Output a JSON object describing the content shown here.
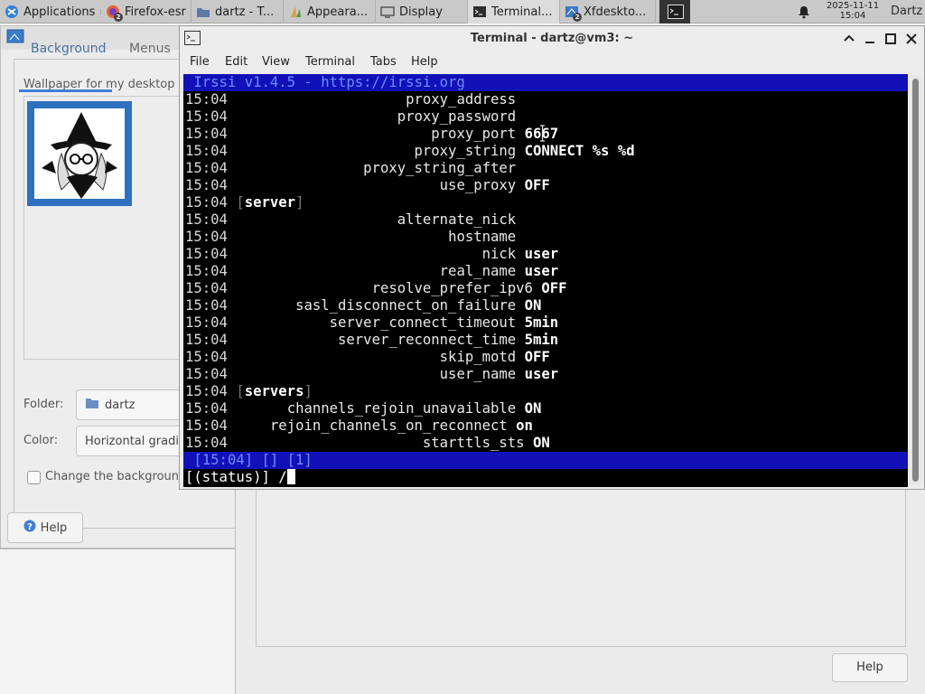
{
  "panel": {
    "applications_label": "Applications",
    "tasks": [
      {
        "label": "Firefox-esr",
        "badge": "2"
      },
      {
        "label": "dartz - T..."
      },
      {
        "label": "Appeara..."
      },
      {
        "label": "Display"
      },
      {
        "label": "Terminal..."
      },
      {
        "label": "Xfdeskto...",
        "badge": "2"
      }
    ],
    "clock_date": "2025-11-11",
    "clock_time": "15:04",
    "user": "Dartz"
  },
  "appearance": {
    "tab_background": "Background",
    "tab_menus": "Menus",
    "wallpaper_label": "Wallpaper for my desktop",
    "folder_label": "Folder:",
    "folder_value": "dartz",
    "color_label": "Color:",
    "color_value": "Horizontal gradi",
    "change_label": "Change the backgroun",
    "help_label": "Help"
  },
  "under_window": {
    "help_label": "Help"
  },
  "terminal": {
    "title": "Terminal - dartz@vm3: ~",
    "menu": [
      "File",
      "Edit",
      "View",
      "Terminal",
      "Tabs",
      "Help"
    ],
    "topic": " Irssi v1.4.5 - https://irssi.org",
    "lines": [
      {
        "time": "15:04",
        "pad": "                    ",
        "key": "proxy_address",
        "value": ""
      },
      {
        "time": "15:04",
        "pad": "                   ",
        "key": "proxy_password",
        "value": ""
      },
      {
        "time": "15:04",
        "pad": "                       ",
        "key": "proxy_port",
        "value": "6667"
      },
      {
        "time": "15:04",
        "pad": "                     ",
        "key": "proxy_string",
        "value": "CONNECT %s %d"
      },
      {
        "time": "15:04",
        "pad": "               ",
        "key": "proxy_string_after",
        "value": ""
      },
      {
        "time": "15:04",
        "pad": "                        ",
        "key": "use_proxy",
        "value": "OFF"
      },
      {
        "time": "15:04",
        "section": "server"
      },
      {
        "time": "15:04",
        "pad": "                   ",
        "key": "alternate_nick",
        "value": ""
      },
      {
        "time": "15:04",
        "pad": "                         ",
        "key": "hostname",
        "value": ""
      },
      {
        "time": "15:04",
        "pad": "                             ",
        "key": "nick",
        "value": "user"
      },
      {
        "time": "15:04",
        "pad": "                        ",
        "key": "real_name",
        "value": "user"
      },
      {
        "time": "15:04",
        "pad": "                ",
        "key": "resolve_prefer_ipv6",
        "value": "OFF"
      },
      {
        "time": "15:04",
        "pad": "       ",
        "key": "sasl_disconnect_on_failure",
        "value": "ON"
      },
      {
        "time": "15:04",
        "pad": "           ",
        "key": "server_connect_timeout",
        "value": "5min"
      },
      {
        "time": "15:04",
        "pad": "            ",
        "key": "server_reconnect_time",
        "value": "5min"
      },
      {
        "time": "15:04",
        "pad": "                        ",
        "key": "skip_motd",
        "value": "OFF"
      },
      {
        "time": "15:04",
        "pad": "                        ",
        "key": "user_name",
        "value": "user"
      },
      {
        "time": "15:04",
        "section": "servers"
      },
      {
        "time": "15:04",
        "pad": "      ",
        "key": "channels_rejoin_unavailable",
        "value": "ON"
      },
      {
        "time": "15:04",
        "pad": "    ",
        "key": "rejoin_channels_on_reconnect",
        "value": "on"
      },
      {
        "time": "15:04",
        "pad": "                      ",
        "key": "starttls_sts",
        "value": "ON"
      }
    ],
    "statusbar": " [15:04] [] [1]",
    "prompt": "[(status)] /"
  }
}
